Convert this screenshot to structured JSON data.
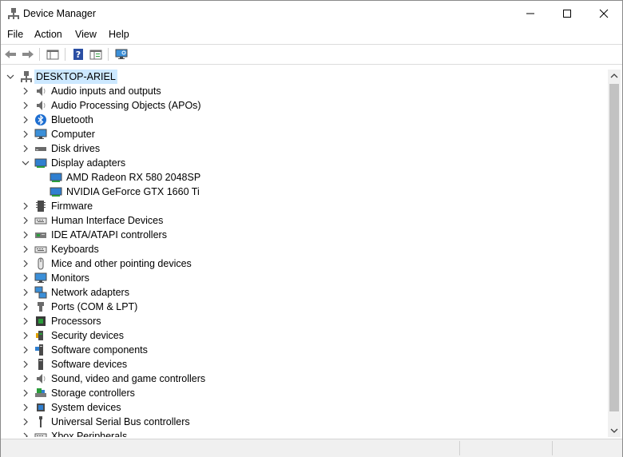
{
  "window": {
    "title": "Device Manager"
  },
  "menu": [
    "File",
    "Action",
    "View",
    "Help"
  ],
  "tree": {
    "root": "DESKTOP-ARIEL",
    "items": [
      {
        "label": "Audio inputs and outputs",
        "icon": "speaker-icon",
        "expanded": false,
        "level": 1
      },
      {
        "label": "Audio Processing Objects (APOs)",
        "icon": "speaker-icon",
        "expanded": false,
        "level": 1
      },
      {
        "label": "Bluetooth",
        "icon": "bluetooth-icon",
        "expanded": false,
        "level": 1
      },
      {
        "label": "Computer",
        "icon": "computer-icon",
        "expanded": false,
        "level": 1
      },
      {
        "label": "Disk drives",
        "icon": "disk-drive-icon",
        "expanded": false,
        "level": 1
      },
      {
        "label": "Display adapters",
        "icon": "display-adapter-icon",
        "expanded": true,
        "level": 1
      },
      {
        "label": "AMD Radeon RX 580 2048SP",
        "icon": "display-adapter-icon",
        "expanded": null,
        "level": 2
      },
      {
        "label": "NVIDIA GeForce GTX 1660 Ti",
        "icon": "display-adapter-icon",
        "expanded": null,
        "level": 2
      },
      {
        "label": "Firmware",
        "icon": "firmware-icon",
        "expanded": false,
        "level": 1
      },
      {
        "label": "Human Interface Devices",
        "icon": "keyboard-icon",
        "expanded": false,
        "level": 1
      },
      {
        "label": "IDE ATA/ATAPI controllers",
        "icon": "controller-icon",
        "expanded": false,
        "level": 1
      },
      {
        "label": "Keyboards",
        "icon": "keyboard-icon",
        "expanded": false,
        "level": 1
      },
      {
        "label": "Mice and other pointing devices",
        "icon": "mouse-icon",
        "expanded": false,
        "level": 1
      },
      {
        "label": "Monitors",
        "icon": "monitor-icon",
        "expanded": false,
        "level": 1
      },
      {
        "label": "Network adapters",
        "icon": "network-icon",
        "expanded": false,
        "level": 1
      },
      {
        "label": "Ports (COM & LPT)",
        "icon": "port-icon",
        "expanded": false,
        "level": 1
      },
      {
        "label": "Processors",
        "icon": "processor-icon",
        "expanded": false,
        "level": 1
      },
      {
        "label": "Security devices",
        "icon": "security-icon",
        "expanded": false,
        "level": 1
      },
      {
        "label": "Software components",
        "icon": "software-component-icon",
        "expanded": false,
        "level": 1
      },
      {
        "label": "Software devices",
        "icon": "software-device-icon",
        "expanded": false,
        "level": 1
      },
      {
        "label": "Sound, video and game controllers",
        "icon": "speaker-icon",
        "expanded": false,
        "level": 1
      },
      {
        "label": "Storage controllers",
        "icon": "storage-icon",
        "expanded": false,
        "level": 1
      },
      {
        "label": "System devices",
        "icon": "system-icon",
        "expanded": false,
        "level": 1
      },
      {
        "label": "Universal Serial Bus controllers",
        "icon": "usb-icon",
        "expanded": false,
        "level": 1
      },
      {
        "label": "Xbox Peripherals",
        "icon": "keyboard-icon",
        "expanded": false,
        "level": 1
      }
    ]
  },
  "colors": {
    "selection": "#cce8ff",
    "accent": "#0a64ad"
  }
}
